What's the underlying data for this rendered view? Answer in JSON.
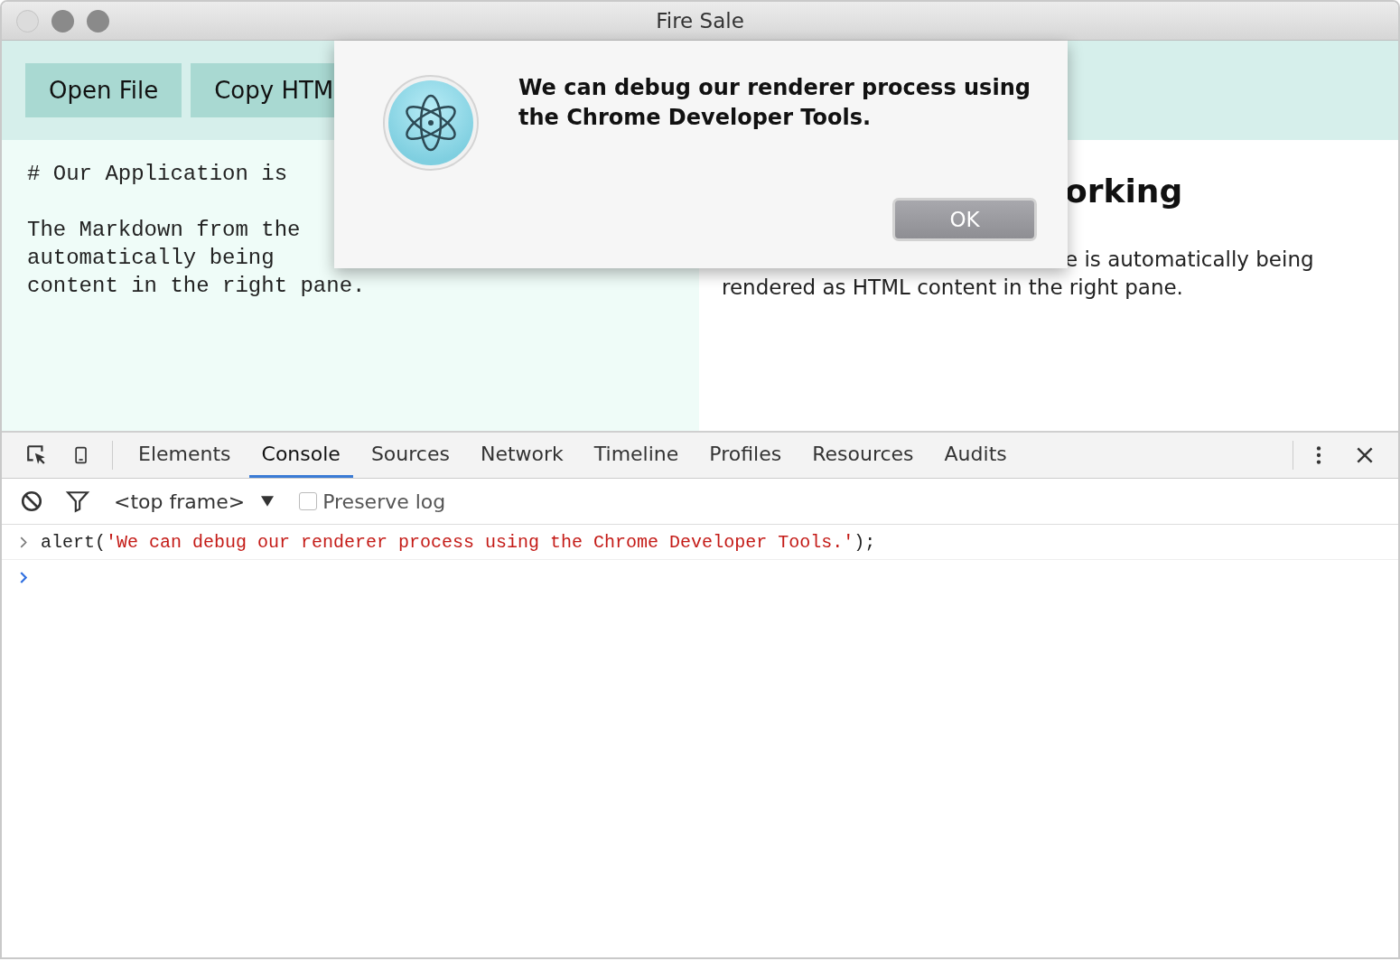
{
  "window": {
    "title": "Fire Sale"
  },
  "toolbar": {
    "buttons": [
      "Open File",
      "Copy HTM"
    ]
  },
  "editor": {
    "heading": "# Our Application is",
    "lines": [
      "The Markdown from the",
      "automatically being",
      "content in the right pane."
    ]
  },
  "preview": {
    "heading": "orking",
    "lines": [
      "e is automatically being",
      "rendered as HTML content in the right pane."
    ]
  },
  "dialog": {
    "message": "We can debug our renderer process using the Chrome Developer Tools.",
    "button": "OK"
  },
  "devtools": {
    "tabs": [
      {
        "label": "Elements",
        "selected": false
      },
      {
        "label": "Console",
        "selected": true
      },
      {
        "label": "Sources",
        "selected": false
      },
      {
        "label": "Network",
        "selected": false
      },
      {
        "label": "Timeline",
        "selected": false
      },
      {
        "label": "Profiles",
        "selected": false
      },
      {
        "label": "Resources",
        "selected": false
      },
      {
        "label": "Audits",
        "selected": false
      }
    ],
    "context": "<top frame>",
    "preserve_log": {
      "label": "Preserve log",
      "checked": false
    },
    "entries": [
      {
        "kind": "input",
        "call": "alert(",
        "string": "'We can debug our renderer process using the Chrome Developer Tools.'",
        "end": ");"
      }
    ]
  }
}
